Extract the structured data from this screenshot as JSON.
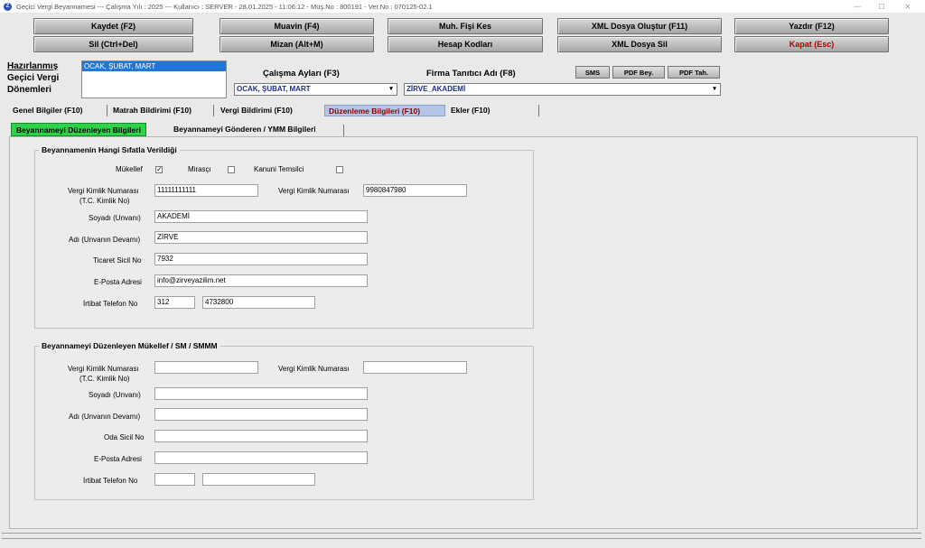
{
  "window": {
    "title": "Geçici Vergi Beyannamesi  ---  Çalışma Yılı : 2025  ---  Kullanıcı : SERVER - 28.01.2025 - 11:06:12 - Müş.No : 800191 - Ver.No : 070125-02.1",
    "controls": {
      "minimize": "—",
      "maximize": "☐",
      "close": "✕"
    }
  },
  "toolbar": {
    "kaydet": "Kaydet (F2)",
    "muavin": "Muavin (F4)",
    "muh_fisi_kes": "Muh. Fişi Kes",
    "xml_olustur": "XML Dosya Oluştur (F11)",
    "yazdir": "Yazdır (F12)",
    "sil": "Sil (Ctrl+Del)",
    "mizan": "Mizan (Alt+M)",
    "hesap_kodlari": "Hesap Kodları",
    "xml_sil": "XML Dosya Sil",
    "kapat": "Kapat (Esc)"
  },
  "left_panel": {
    "label_line1": "Hazırlanmış",
    "label_line2": "Geçici Vergi",
    "label_line3": "Dönemleri",
    "periods": [
      "OCAK, ŞUBAT, MART"
    ]
  },
  "top_fields": {
    "calisma_aylari_label": "Çalışma Ayları (F3)",
    "calisma_aylari_value": "OCAK, ŞUBAT, MART",
    "firma_label": "Firma Tanıtıcı Adı (F8)",
    "firma_value": "ZİRVE_AKADEMİ",
    "sms": "SMS",
    "pdf_bey": "PDF Bey.",
    "pdf_tah": "PDF Tah."
  },
  "tabs": [
    {
      "label": "Genel Bilgiler (F10)"
    },
    {
      "label": "Matrah Bildirimi (F10)"
    },
    {
      "label": "Vergi Bildirimi (F10)"
    },
    {
      "label": "Düzenleme Bilgileri  (F10)"
    },
    {
      "label": "Ekler (F10)"
    }
  ],
  "subtabs": [
    {
      "label": "Beyannameyi Düzenleyen Bilgileri"
    },
    {
      "label": "Beyannameyi Gönderen / YMM Bilgileri"
    }
  ],
  "group1": {
    "title": "Beyannamenin Hangi Sıfatla Verildiği",
    "mukellef": "Mükellef",
    "mirasci": "Mirasçı",
    "kanuni_temsilci": "Kanuni Temsilci",
    "mukellef_check": "✓",
    "vkn_label_1": "Vergi Kimlik Numarası",
    "vkn_label_2": "(T.C. Kimlik No)",
    "vkn_value": "11111111111",
    "vkn2_label": "Vergi Kimlik Numarası",
    "vkn2_value": "9980847980",
    "soyadi_label": "Soyadı (Unvanı)",
    "soyadi_value": "AKADEMİ",
    "adi_label": "Adı (Unvanın Devamı)",
    "adi_value": "ZİRVE",
    "ticaret_label": "Ticaret Sicil No",
    "ticaret_value": "7932",
    "eposta_label": "E-Posta Adresi",
    "eposta_value": "info@zirveyazilim.net",
    "telefon_label": "İrtibat Telefon No",
    "telefon_alan": "312",
    "telefon_no": "4732800"
  },
  "group2": {
    "title": "Beyannameyi Düzenleyen Mükellef / SM / SMMM",
    "vkn_label_1": "Vergi Kimlik Numarası",
    "vkn_label_2": "(T.C. Kimlik No)",
    "vkn2_label": "Vergi Kimlik Numarası",
    "soyadi_label": "Soyadı (Unvanı)",
    "adi_label": "Adı (Unvanın Devamı)",
    "oda_label": "Oda Sicil No",
    "eposta_label": "E-Posta Adresi",
    "telefon_label": "İrtibat Telefon No"
  }
}
